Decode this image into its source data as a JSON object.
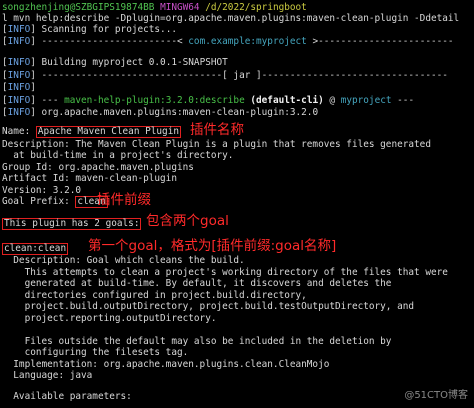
{
  "prompt": {
    "user_host": "songzhenjing@SZBGIPS19874BB",
    "shell": "MINGW64",
    "path": "/d/2022/springboot"
  },
  "command": "l mvn help:describe -Dplugin=org.apache.maven.plugins:maven-clean-plugin -Ddetail",
  "info_tag": "INFO",
  "log": {
    "scanning": "Scanning for projects...",
    "dashes_left": "------------------------< ",
    "project_coords": "com.example:myproject",
    "dashes_right": " >------------------------",
    "building": "Building myproject 0.0.1-SNAPSHOT",
    "jar_rule": "--------------------------------[ jar ]---------------------------------",
    "plugin_dash": "--- ",
    "plugin_ref": "maven-help-plugin:3.2.0:describe",
    "execution": " (default-cli)",
    "at": " @ ",
    "project_name": "myproject",
    "plugin_dash_end": " ---",
    "plugin_id": "org.apache.maven.plugins:maven-clean-plugin:3.2.0"
  },
  "details": {
    "name_label": "Name: ",
    "name_value": "Apache Maven Clean Plugin",
    "description_1": "Description: The Maven Clean Plugin is a plugin that removes files generated",
    "description_2": "  at build-time in a project's directory.",
    "group_id": "Group Id: org.apache.maven.plugins",
    "artifact_id": "Artifact Id: maven-clean-plugin",
    "version": "Version: 3.2.0",
    "goal_prefix_label": "Goal Prefix: ",
    "goal_prefix_value": "clean",
    "goal_count": "This plugin has 2 goals:",
    "goal_name": "clean:clean",
    "goal_desc_head": "  Description: Goal which cleans the build.",
    "goal_desc_lines": [
      "    This attempts to clean a project's working directory of the files that were",
      "    generated at build-time. By default, it discovers and deletes the",
      "    directories configured in project.build.directory,",
      "    project.build.outputDirectory, project.build.testOutputDirectory, and",
      "    project.reporting.outputDirectory."
    ],
    "goal_desc_tail": [
      "    Files outside the default may also be included in the deletion by",
      "    configuring the filesets tag."
    ],
    "implementation": "  Implementation: org.apache.maven.plugins.clean.CleanMojo",
    "language": "  Language: java",
    "available_params": "  Available parameters:"
  },
  "annotations": {
    "plugin_name": "插件名称",
    "plugin_prefix": "插件前缀",
    "two_goals": "包含两个goal",
    "first_goal": "第一个goal，格式为[插件前缀:goal名称]"
  },
  "watermark": "@51CTO博客",
  "colors": {
    "background": "#000000",
    "text": "#d8d8d8",
    "info": "#6aa0e0",
    "green": "#48c048",
    "cyan": "#45a6bf",
    "annotation": "#ff2a2a"
  }
}
